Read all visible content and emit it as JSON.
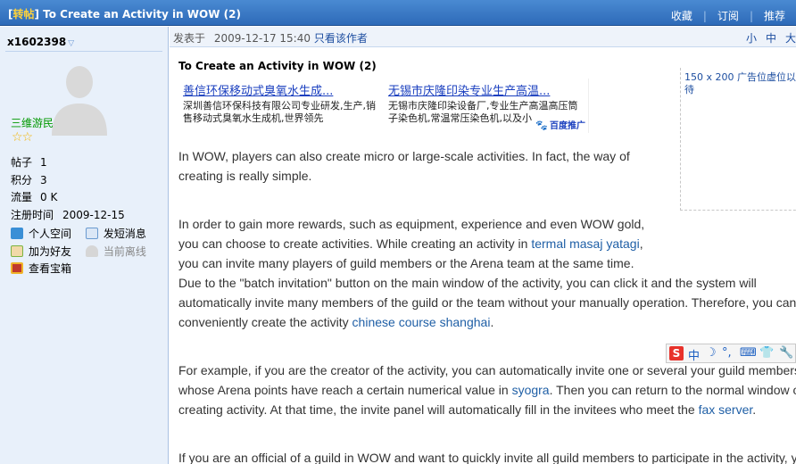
{
  "titlebar": {
    "tag_open": "[",
    "tag": "转帖",
    "tag_close": "]",
    "title": "To Create an Activity in WOW (2)",
    "actions": [
      "收藏",
      "订阅",
      "推荐"
    ],
    "separator": "|"
  },
  "sidebar": {
    "username": "x1602398",
    "caret": "▽",
    "group": "三维游民",
    "stars": "☆☆",
    "stats": [
      {
        "label": "帖子",
        "value": "1"
      },
      {
        "label": "积分",
        "value": "3"
      },
      {
        "label": "流量",
        "value": "0 K"
      },
      {
        "label": "注册时间",
        "value": "2009-12-15"
      }
    ],
    "links": [
      {
        "label": "个人空间",
        "icon": "home-icon",
        "color": "#3a8fd6"
      },
      {
        "label": "发短消息",
        "icon": "message-icon",
        "color": "#6a9ad0"
      },
      {
        "label": "加为好友",
        "icon": "add-friend-icon",
        "color": "#7cb342"
      },
      {
        "label": "当前离线",
        "icon": "offline-user-icon",
        "color": "#a0a0a0"
      },
      {
        "label": "查看宝箱",
        "icon": "treasure-box-icon",
        "color": "#c0392b"
      }
    ]
  },
  "posthead": {
    "posted_label": "发表于",
    "datetime": "2009-12-17 15:40",
    "author_only": "只看该作者",
    "font_sizes": [
      "小",
      "中",
      "大"
    ]
  },
  "post": {
    "title": "To Create an Activity in WOW (2)",
    "ads": [
      {
        "headline": "善信环保移动式臭氧水生成...",
        "desc": "深圳善信环保科技有限公司专业研发,生产,销售移动式臭氧水生成机,世界领先"
      },
      {
        "headline": "无锡市庆隆印染专业生产高温...",
        "desc": "无锡市庆隆印染设备厂,专业生产高温高压筒子染色机,常温常压染色机,以及小"
      }
    ],
    "baidu_label": "百度推广",
    "placeholder_text_1": "150 x 200 广告位虚位以",
    "placeholder_text_2": "待",
    "p1_line1": "In WOW, players can also create micro or large-scale activities. In fact, the way of",
    "p1_line2": "creating is really simple.",
    "p2_line1": "In order to gain more rewards, such as equipment, experience and even WOW gold,",
    "p2_line2_a": "you can choose to create activities. While creating an activity in ",
    "p2_line2_link": "termal masaj yatagi",
    "p2_line2_b": ",",
    "p2_line3": "you can invite many players of guild members or the Arena team at the same time.",
    "p2_line4": "Due to the \"batch invitation\" button on the main window of the activity, you can click it and the system will",
    "p2_line5": "automatically invite many members of the guild or the team without your manually operation. Therefore, you can",
    "p2_line6_a": "conveniently create the activity ",
    "p2_line6_link": "chinese course shanghai",
    "p2_line6_b": ".",
    "p3_line1": "For example, if you are the creator of the activity, you can automatically invite one or several your guild members",
    "p3_line2_a": "whose Arena points have reach a certain numerical value in ",
    "p3_line2_link": "syogra",
    "p3_line2_b": ". Then you can return to the normal window of",
    "p3_line3_a": "creating activity. At that time, the invite panel will automatically fill in the invitees who meet the ",
    "p3_line3_link": "fax server",
    "p3_line3_b": ".",
    "p4_line1": "If you are an official of a guild in WOW and want to quickly invite all guild members to participate in the activity, you"
  },
  "ime": {
    "logo": "S",
    "items": [
      "中",
      "☽",
      "°,",
      "⌨",
      "👕",
      "🔧"
    ]
  }
}
